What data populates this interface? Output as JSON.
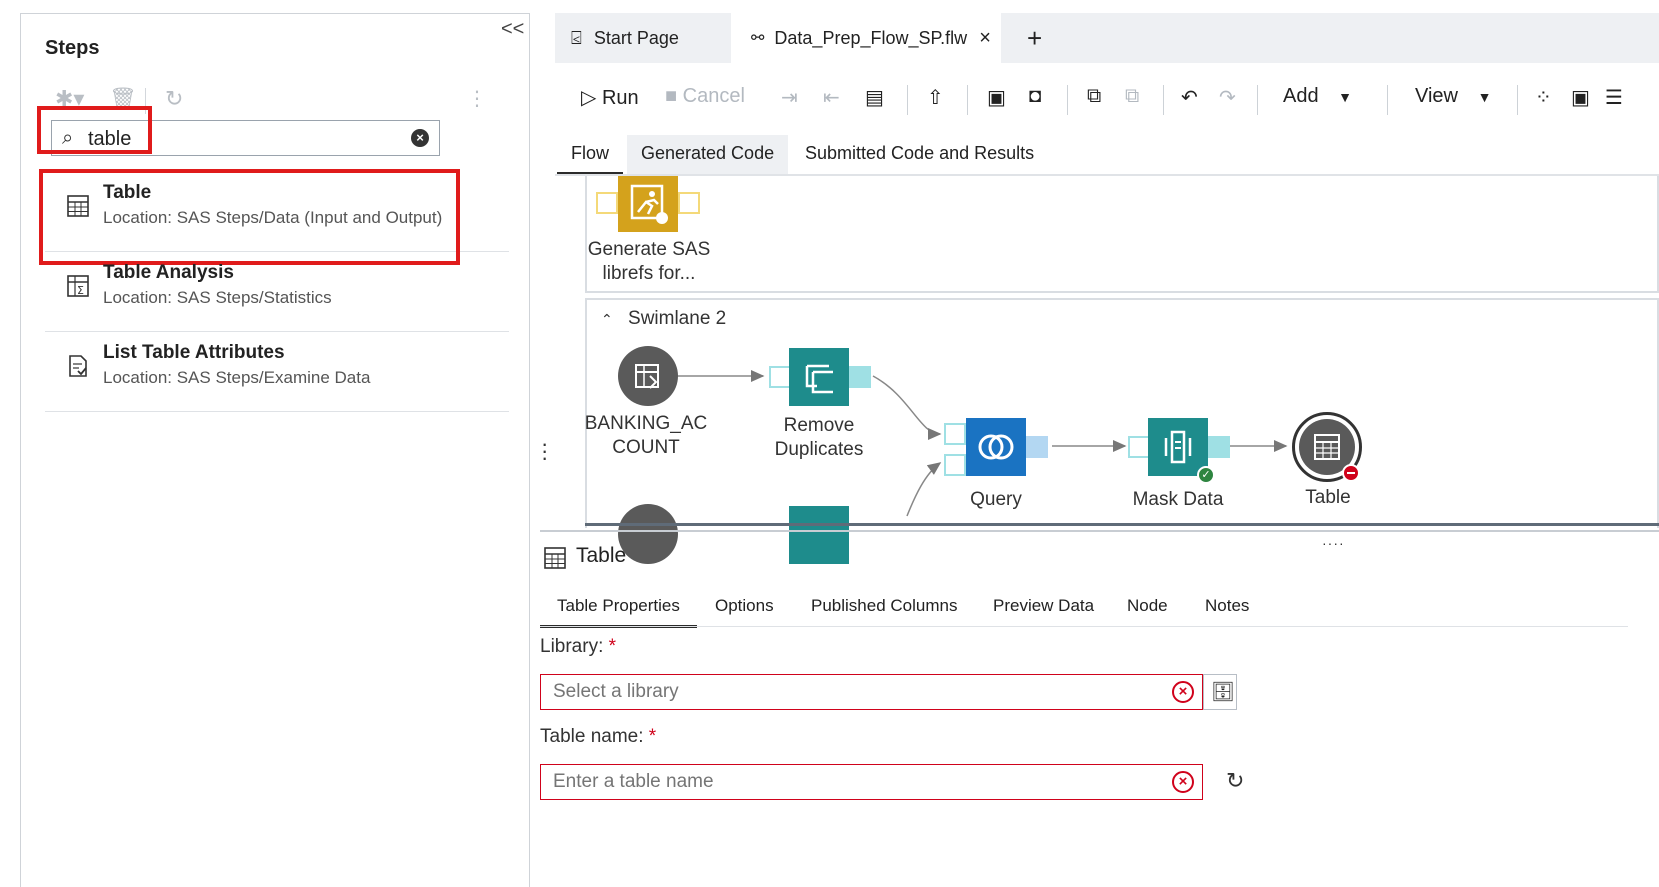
{
  "steps_pane": {
    "title": "Steps",
    "collapse_glyph": "<<",
    "search": {
      "value": "table",
      "placeholder": ""
    },
    "results": [
      {
        "title": "Table",
        "location": "Location: SAS Steps/Data (Input and Output)",
        "icon": "table-icon",
        "highlighted": true
      },
      {
        "title": "Table Analysis",
        "location": "Location: SAS Steps/Statistics",
        "icon": "table-analysis-icon",
        "highlighted": false
      },
      {
        "title": "List Table Attributes",
        "location": "Location: SAS Steps/Examine Data",
        "icon": "list-attributes-icon",
        "highlighted": false
      }
    ],
    "highlight_color": "#e01b1b"
  },
  "tabs": {
    "start_page": "Start Page",
    "flow_file": "Data_Prep_Flow_SP.flw",
    "close_glyph": "×",
    "add_glyph": "+"
  },
  "toolbar": {
    "run": "Run",
    "cancel": "Cancel",
    "add": "Add",
    "view": "View"
  },
  "view_tabs": {
    "flow": "Flow",
    "generated": "Generated Code",
    "submitted": "Submitted Code and Results"
  },
  "flow": {
    "lane1_node": {
      "label_line1": "Generate SAS",
      "label_line2": "librefs for..."
    },
    "swimlane_title": "Swimlane 2",
    "nodes": {
      "source_line1": "BANKING_AC",
      "source_line2": "COUNT",
      "remove_line1": "Remove",
      "remove_line2": "Duplicates",
      "query": "Query",
      "mask": "Mask Data",
      "table": "Table"
    },
    "colors": {
      "teal": "#1e8c8c",
      "query_blue": "#1a73c2",
      "gold": "#d4a21c",
      "dark_node": "#5a5a5a",
      "error_red": "#d0021b",
      "ok_green": "#2e8540"
    }
  },
  "properties": {
    "title": "Table",
    "tabs": [
      "Table Properties",
      "Options",
      "Published Columns",
      "Preview Data",
      "Node",
      "Notes"
    ],
    "library_label": "Library:",
    "library_placeholder": "Select a library",
    "table_label": "Table name:",
    "table_placeholder": "Enter a table name",
    "required_mark": "*"
  }
}
